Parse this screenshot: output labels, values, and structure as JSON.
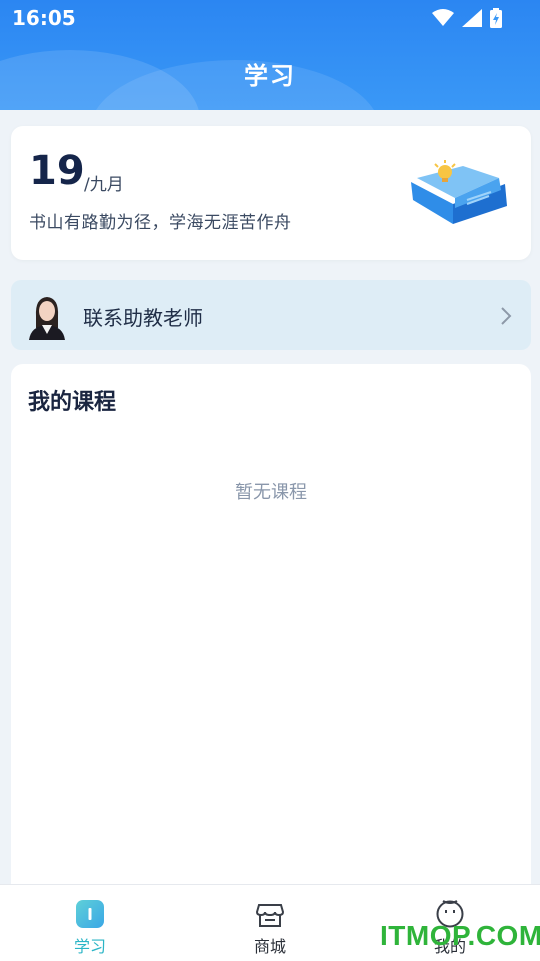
{
  "status_bar": {
    "time": "16:05"
  },
  "header": {
    "title": "学习"
  },
  "date_card": {
    "day": "19",
    "month": "/九月",
    "motto": "书山有路勤为径，学海无涯苦作舟"
  },
  "contact": {
    "label": "联系助教老师"
  },
  "courses": {
    "title": "我的课程",
    "empty_text": "暂无课程"
  },
  "nav": {
    "items": [
      {
        "label": "学习",
        "icon": "study-icon",
        "active": true
      },
      {
        "label": "商城",
        "icon": "store-icon",
        "active": false
      },
      {
        "label": "我的",
        "icon": "profile-icon",
        "active": false
      }
    ]
  },
  "watermark": {
    "text": "ITMOP.COM"
  },
  "colors": {
    "header": "#2b86f2",
    "accent": "#2bb5c6",
    "watermark": "#2fb43a"
  }
}
